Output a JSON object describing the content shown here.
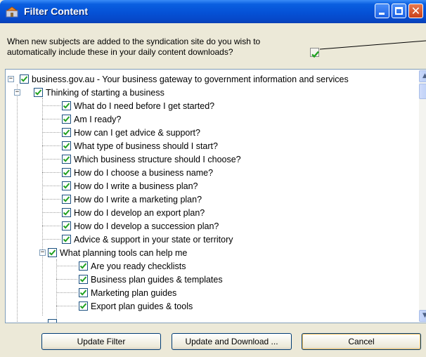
{
  "window": {
    "title": "Filter Content",
    "prompt": "When new subjects are added to the syndication site do you wish to automatically include these in your daily content downloads?",
    "auto_include_checked": true
  },
  "tree": {
    "root": "business.gov.au - Your business gateway to government information and services",
    "group1": "Thinking of starting a business",
    "items": [
      "What do I need before I get started?",
      "Am I ready?",
      "How can I get advice & support?",
      "What type of business should I start?",
      "Which business structure should I choose?",
      "How do I choose a business name?",
      "How do I write a business plan?",
      "How do I write a marketing plan?",
      "How do I develop an export plan?",
      "How do I develop a succession plan?",
      "Advice & support in your state or territory"
    ],
    "group2": "What planning tools can help me",
    "subitems": [
      "Are you ready checklists",
      "Business plan guides & templates",
      "Marketing plan guides",
      "Export plan guides & tools"
    ]
  },
  "buttons": {
    "update_filter": "Update Filter",
    "update_download": "Update and Download ...",
    "cancel": "Cancel"
  },
  "colors": {
    "titlebar": "#0551d6",
    "check": "#21a121",
    "window_bg": "#ece9d8"
  }
}
